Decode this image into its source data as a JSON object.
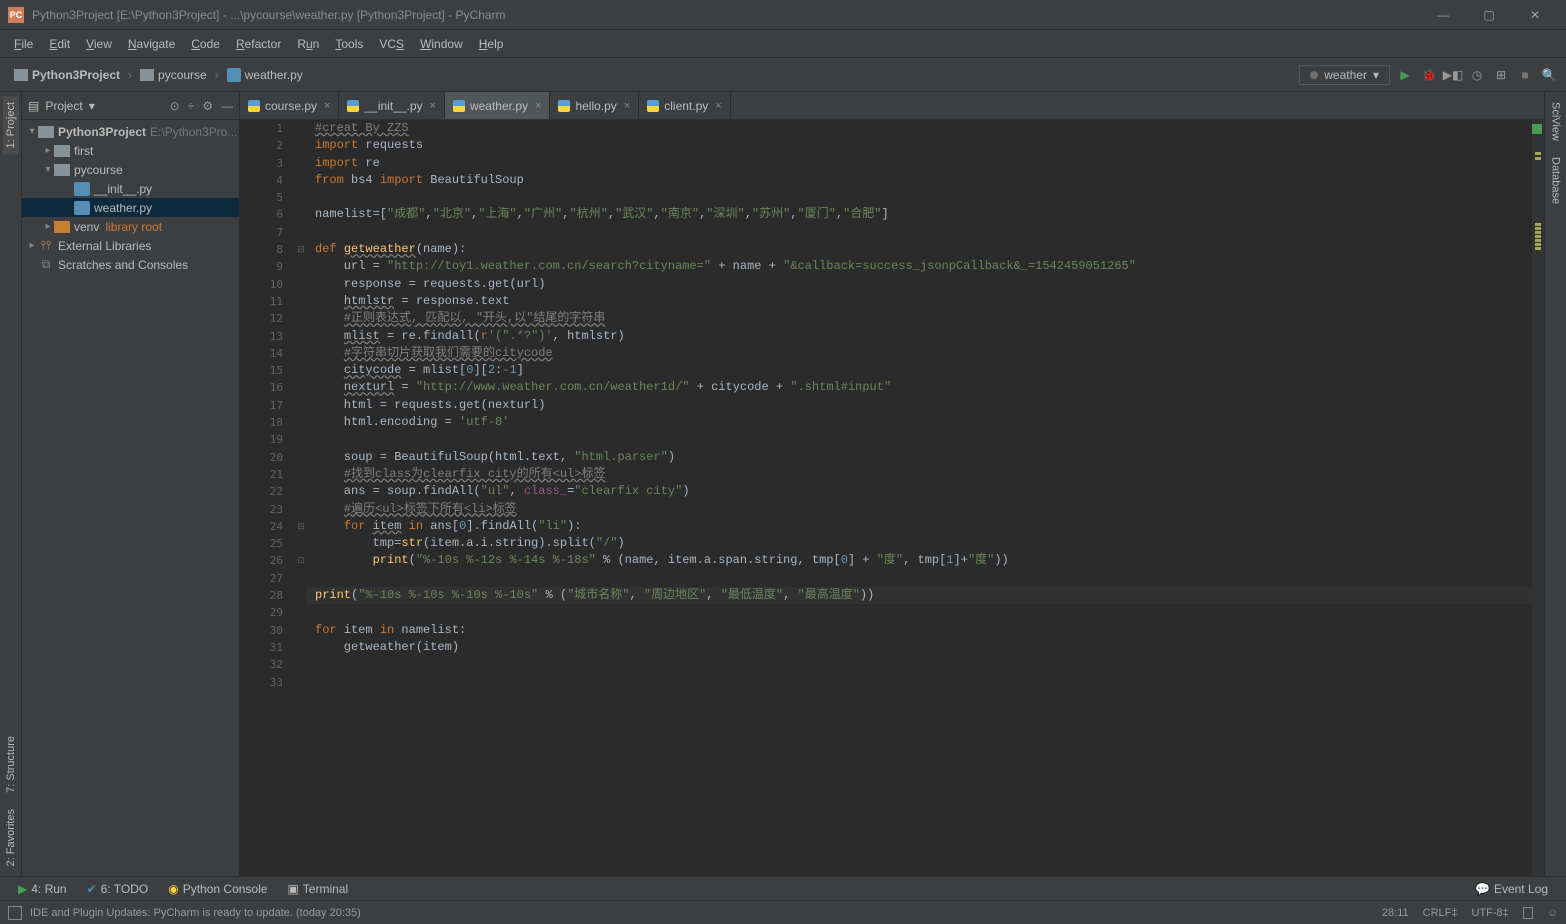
{
  "title": "Python3Project [E:\\Python3Project] - ...\\pycourse\\weather.py [Python3Project] - PyCharm",
  "menu": [
    "File",
    "Edit",
    "View",
    "Navigate",
    "Code",
    "Refactor",
    "Run",
    "Tools",
    "VCS",
    "Window",
    "Help"
  ],
  "breadcrumb": {
    "root": "Python3Project",
    "folder": "pycourse",
    "file": "weather.py"
  },
  "runConfig": "weather",
  "projectPanel": {
    "title": "Project"
  },
  "tree": {
    "root": {
      "name": "Python3Project",
      "path": "E:\\Python3Pro..."
    },
    "first": "first",
    "pycourse": "pycourse",
    "init": "__init__.py",
    "weather": "weather.py",
    "venv": "venv",
    "venvNote": "library root",
    "extlib": "External Libraries",
    "scratch": "Scratches and Consoles"
  },
  "tabs": [
    {
      "label": "course.py",
      "active": false
    },
    {
      "label": "__init__.py",
      "active": false
    },
    {
      "label": "weather.py",
      "active": true
    },
    {
      "label": "hello.py",
      "active": false
    },
    {
      "label": "client.py",
      "active": false
    }
  ],
  "leftTabs": [
    "1: Project",
    "7: Structure",
    "2: Favorites"
  ],
  "rightTabs": [
    "SciView",
    "Database"
  ],
  "code": [
    {
      "n": 1,
      "t": "#creat By ZZS",
      "cls": "cmt under"
    },
    {
      "n": 2,
      "t": "import requests",
      "kw": "import",
      "rest": " requests"
    },
    {
      "n": 3,
      "t": "import re",
      "kw": "import",
      "rest": " re"
    },
    {
      "n": 4,
      "html": "<span class='kw'>from</span> bs4 <span class='kw'>import</span> BeautifulSoup"
    },
    {
      "n": 5,
      "t": ""
    },
    {
      "n": 6,
      "html": "namelist=[<span class='str'>\"成都\"</span>,<span class='str'>\"北京\"</span>,<span class='str'>\"上海\"</span>,<span class='str'>\"广州\"</span>,<span class='str'>\"杭州\"</span>,<span class='str'>\"武汉\"</span>,<span class='str'>\"南京\"</span>,<span class='str'>\"深圳\"</span>,<span class='str'>\"苏州\"</span>,<span class='str'>\"厦门\"</span>,<span class='str'>\"合肥\"</span>]"
    },
    {
      "n": 7,
      "t": ""
    },
    {
      "n": 8,
      "html": "<span class='kw'>def</span> <span class='fn under'>getweather</span>(name):",
      "fold": "⊟"
    },
    {
      "n": 9,
      "html": "    url = <span class='str'>\"http://toy1.weather.com.cn/search?cityname=\"</span> + name + <span class='str'>\"&callback=success_jsonpCallback&_=1542459051265\"</span>"
    },
    {
      "n": 10,
      "html": "    response = requests.get(url)"
    },
    {
      "n": 11,
      "html": "    <span class='under'>htmlstr</span> = response.text"
    },
    {
      "n": 12,
      "html": "    <span class='cmt under'>#正则表达式, 匹配以, \"开头,以\"结尾的字符串</span>"
    },
    {
      "n": 13,
      "html": "    <span class='under'>mlist</span> = re.findall(<span class='kw'>r</span><span class='str'>'(\".*?\")'</span>, htmlstr)"
    },
    {
      "n": 14,
      "html": "    <span class='cmt under'>#字符串切片获取我们需要的citycode</span>"
    },
    {
      "n": 15,
      "html": "    <span class='under'>citycode</span> = mlist[<span class='num'>0</span>][<span class='num'>2</span>:<span class='num'>-1</span>]"
    },
    {
      "n": 16,
      "html": "    <span class='under'>nexturl</span> = <span class='str'>\"http://www.weather.com.cn/weather1d/\"</span> + citycode + <span class='str'>\".shtml#input\"</span>"
    },
    {
      "n": 17,
      "html": "    html = requests.get(nexturl)"
    },
    {
      "n": 18,
      "html": "    html.encoding = <span class='str'>'utf-8'</span>"
    },
    {
      "n": 19,
      "t": ""
    },
    {
      "n": 20,
      "html": "    soup = BeautifulSoup(html.text, <span class='str'>\"html.parser\"</span>)"
    },
    {
      "n": 21,
      "html": "    <span class='cmt under'>#找到class为clearfix city的所有&lt;ul&gt;标签</span>"
    },
    {
      "n": 22,
      "html": "    ans = soup.findAll(<span class='str'>\"ul\"</span>, <span class='self'>class_</span>=<span class='str'>\"clearfix city\"</span>)"
    },
    {
      "n": 23,
      "html": "    <span class='cmt under'>#遍历&lt;ul&gt;标签下所有&lt;li&gt;标签</span>"
    },
    {
      "n": 24,
      "html": "    <span class='kw'>for</span> <span class='under'>item</span> <span class='kw'>in</span> ans[<span class='num'>0</span>].findAll(<span class='str'>\"li\"</span>):",
      "fold": "⊟"
    },
    {
      "n": 25,
      "html": "        tmp=<span class='fn'>str</span>(item.a.i.string).split(<span class='str'>\"/\"</span>)"
    },
    {
      "n": 26,
      "html": "        <span class='fn'>print</span>(<span class='str'>\"%-10s %-12s %-14s %-18s\"</span> % (name, item.a.span.string, tmp[<span class='num'>0</span>] + <span class='str'>\"度\"</span>, tmp[<span class='num'>1</span>]+<span class='str'>\"度\"</span>))",
      "fold": "⊡"
    },
    {
      "n": 27,
      "t": ""
    },
    {
      "n": 28,
      "html": "<span class='fn'>print</span>(<span class='str'>\"%-10s %-10s %-10s %-10s\"</span> % (<span class='str'>\"城市名称\"</span>, <span class='str'>\"周边地区\"</span>, <span class='str'>\"最低温度\"</span>, <span class='str'>\"最高温度\"</span>))",
      "hl": true
    },
    {
      "n": 29,
      "t": ""
    },
    {
      "n": 30,
      "html": "<span class='kw'>for</span> item <span class='kw'>in</span> namelist:"
    },
    {
      "n": 31,
      "html": "    getweather(item)"
    },
    {
      "n": 32,
      "t": ""
    },
    {
      "n": 33,
      "t": ""
    }
  ],
  "bottomTools": {
    "run": "4: Run",
    "todo": "6: TODO",
    "console": "Python Console",
    "terminal": "Terminal",
    "eventlog": "Event Log"
  },
  "status": {
    "msg": "IDE and Plugin Updates: PyCharm is ready to update. (today 20:35)",
    "pos": "28:11",
    "eol": "CRLF‡",
    "enc": "UTF-8‡"
  }
}
